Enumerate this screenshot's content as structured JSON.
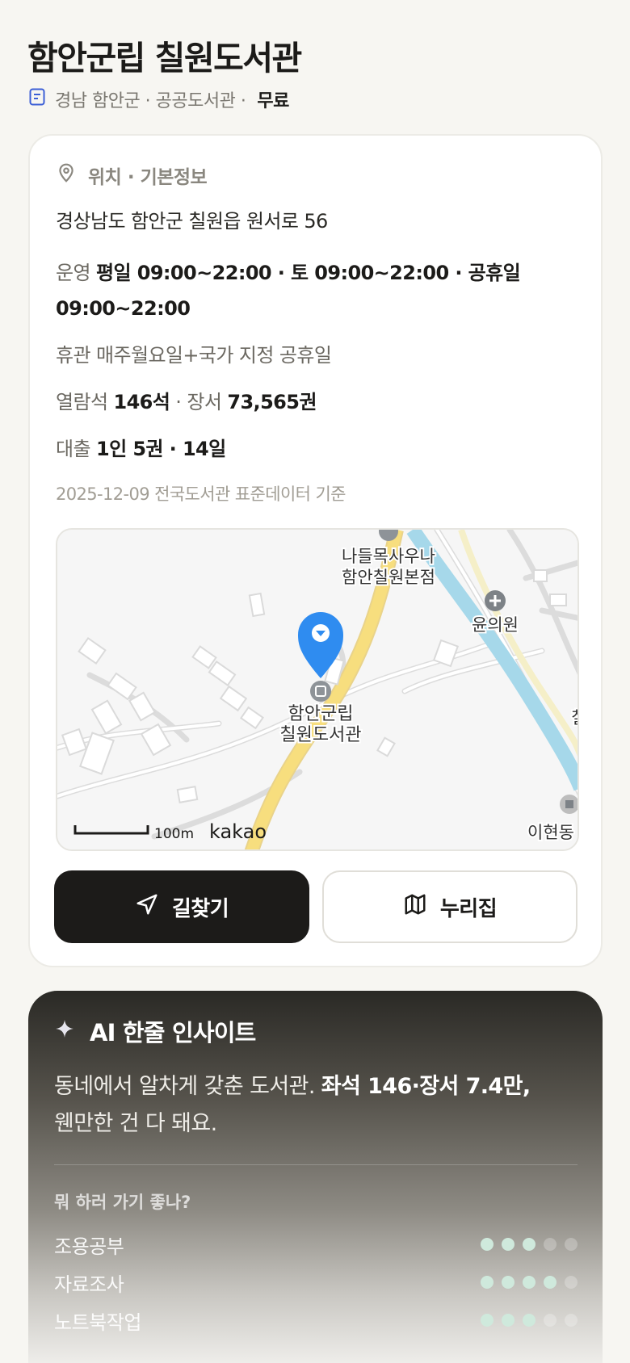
{
  "library": {
    "name": "함안군립 칠원도서관",
    "region": "경남 함안군 · 공공도서관 ·",
    "fee": "무료"
  },
  "info": {
    "section_title": "위치 · 기본정보",
    "address": "경상남도 함안군 칠원읍 원서로 56",
    "hours_label": "운영",
    "hours_value": "평일 09:00~22:00 · 토 09:00~22:00 · 공휴일 09:00~22:00",
    "closed_label": "휴관",
    "closed_value": "매주월요일+국가 지정 공휴일",
    "seats_label": "열람석",
    "seats_value": "146석",
    "sep": "·",
    "books_label": "장서",
    "books_value": "73,565권",
    "loan_label": "대출",
    "loan_value": "1인 5권 · 14일",
    "source": "2025-12-09 전국도서관 표준데이터 기준"
  },
  "map": {
    "poi_sauna_line1": "나들목사우나",
    "poi_sauna_line2": "함안칠원본점",
    "poi_clinic": "윤의원",
    "marker_line1": "함안군립",
    "marker_line2": "칠원도서관",
    "poi_edge": "칠",
    "poi_dong": "이현동",
    "scale": "100m",
    "brand": "kakao"
  },
  "buttons": {
    "directions": "길찾기",
    "website": "누리집"
  },
  "ai": {
    "title": "AI 한줄 인사이트",
    "text_plain": "동네에서 알차게 갖춘 도서관. ",
    "text_bold": "좌석 146·장서 7.4만,",
    "text_tail": "웬만한 건 다 돼요.",
    "question": "뭐 하러 가기 좋나?",
    "activities": [
      {
        "label": "조용공부",
        "score": 3,
        "max": 5
      },
      {
        "label": "자료조사",
        "score": 4,
        "max": 5
      },
      {
        "label": "노트북작업",
        "score": 3,
        "max": 5
      }
    ]
  },
  "colors": {
    "background": "#f7f6f2",
    "primary": "#1c1b19",
    "marker": "#2f8cf0",
    "road_main": "#f7de7e",
    "river": "#a6d8ea",
    "dot_on": "#cfe9dc"
  }
}
